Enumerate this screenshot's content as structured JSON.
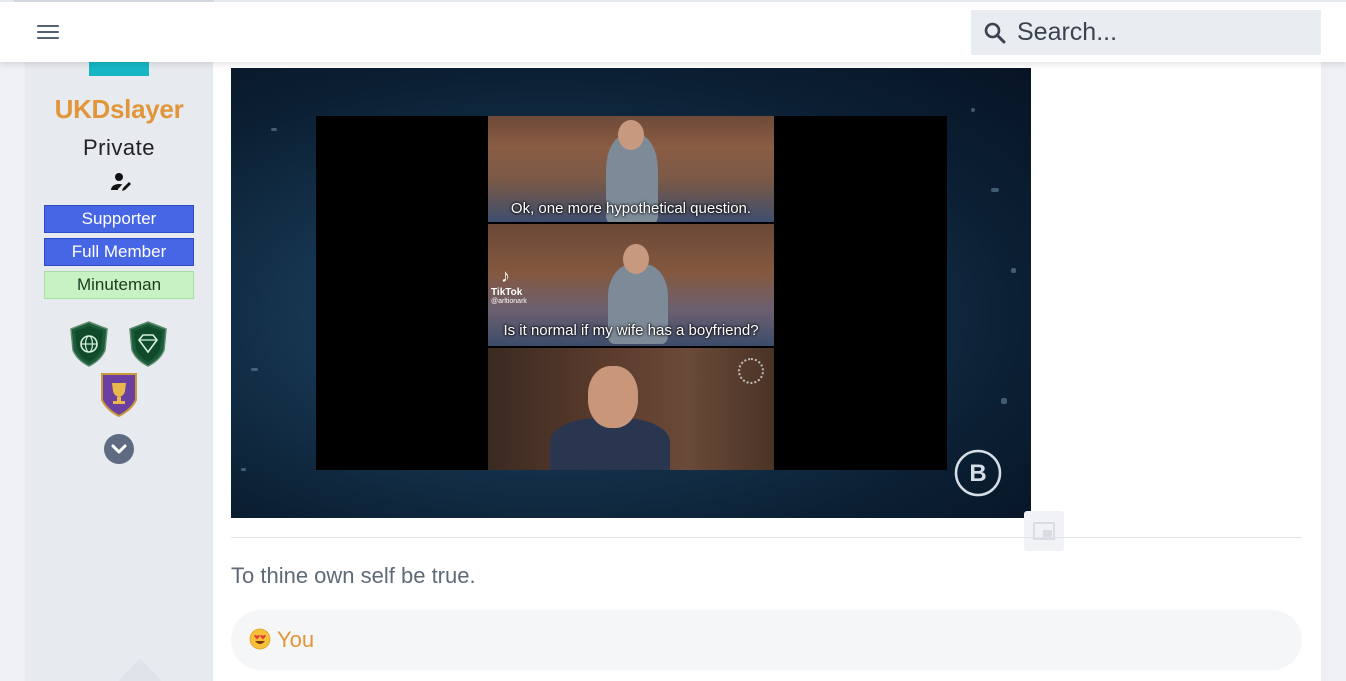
{
  "header": {
    "menu_icon": "hamburger-menu-icon",
    "search": {
      "placeholder": "Search...",
      "icon": "search-icon"
    }
  },
  "sidebar": {
    "username": "UKDslayer",
    "rank": "Private",
    "user_icon": "user-edit-icon",
    "badges": [
      {
        "label": "Supporter",
        "color": "#4766e6"
      },
      {
        "label": "Full Member",
        "color": "#4766e6"
      },
      {
        "label": "Minuteman",
        "color": "#c7f2c4"
      }
    ],
    "trophies": [
      "globe-shield-trophy-icon",
      "diamond-shield-trophy-icon",
      "cup-shield-trophy-icon"
    ],
    "expand_icon": "chevron-down-icon"
  },
  "post": {
    "media": {
      "captions": [
        "Ok, one more hypothetical question.",
        "Is it normal if my wife has a boyfriend?"
      ],
      "tiktok_label": "TikTok",
      "tiktok_handle": "@arltionark",
      "brand_icon": "bitchute-logo-icon"
    },
    "signature": "To thine own self be true.",
    "reactions": {
      "emoji": "heart-eyes-emoji",
      "users": "You"
    }
  },
  "colors": {
    "accent_orange": "#e2963a",
    "badge_blue": "#4766e6",
    "badge_green": "#c7f2c4",
    "avatar_teal": "#17b6c4"
  }
}
